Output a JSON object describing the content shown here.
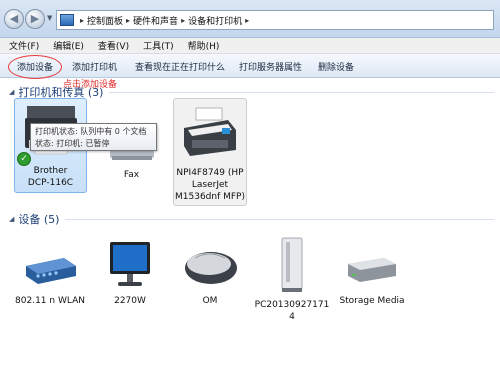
{
  "breadcrumb": [
    "控制面板",
    "硬件和声音",
    "设备和打印机"
  ],
  "menu": [
    "文件(F)",
    "编辑(E)",
    "查看(V)",
    "工具(T)",
    "帮助(H)"
  ],
  "toolbar": {
    "add_device": "添加设备",
    "add_printer": "添加打印机",
    "see_printing": "查看现在正在打印什么",
    "server_props": "打印服务器属性",
    "remove_device": "删除设备"
  },
  "annotation": "点击添加设备",
  "printers_section": {
    "title": "打印机和传真 (3)"
  },
  "devices_section": {
    "title": "设备 (5)"
  },
  "tooltip": {
    "line1": "打印机状态: 队列中有 0 个文档",
    "line2": "状态: 打印机: 已暂停"
  },
  "printers": [
    {
      "label_line1": "Brother",
      "label_line2": "DCP-116C"
    },
    {
      "label_line1": "Fax"
    },
    {
      "label_line1": "NPI4F8749 (HP",
      "label_line2": "LaserJet",
      "label_line3": "M1536dnf MFP)"
    }
  ],
  "devices": [
    {
      "label_line1": "802.11 n WLAN"
    },
    {
      "label_line1": "2270W"
    },
    {
      "label_line1": "OM"
    },
    {
      "label_line1": "PC20130927171",
      "label_line2": "4"
    },
    {
      "label_line1": "Storage Media"
    }
  ],
  "colors": {
    "annotation_red": "#e22c2c",
    "section_blue": "#1e3f78",
    "selection": "#c8e0f8"
  }
}
